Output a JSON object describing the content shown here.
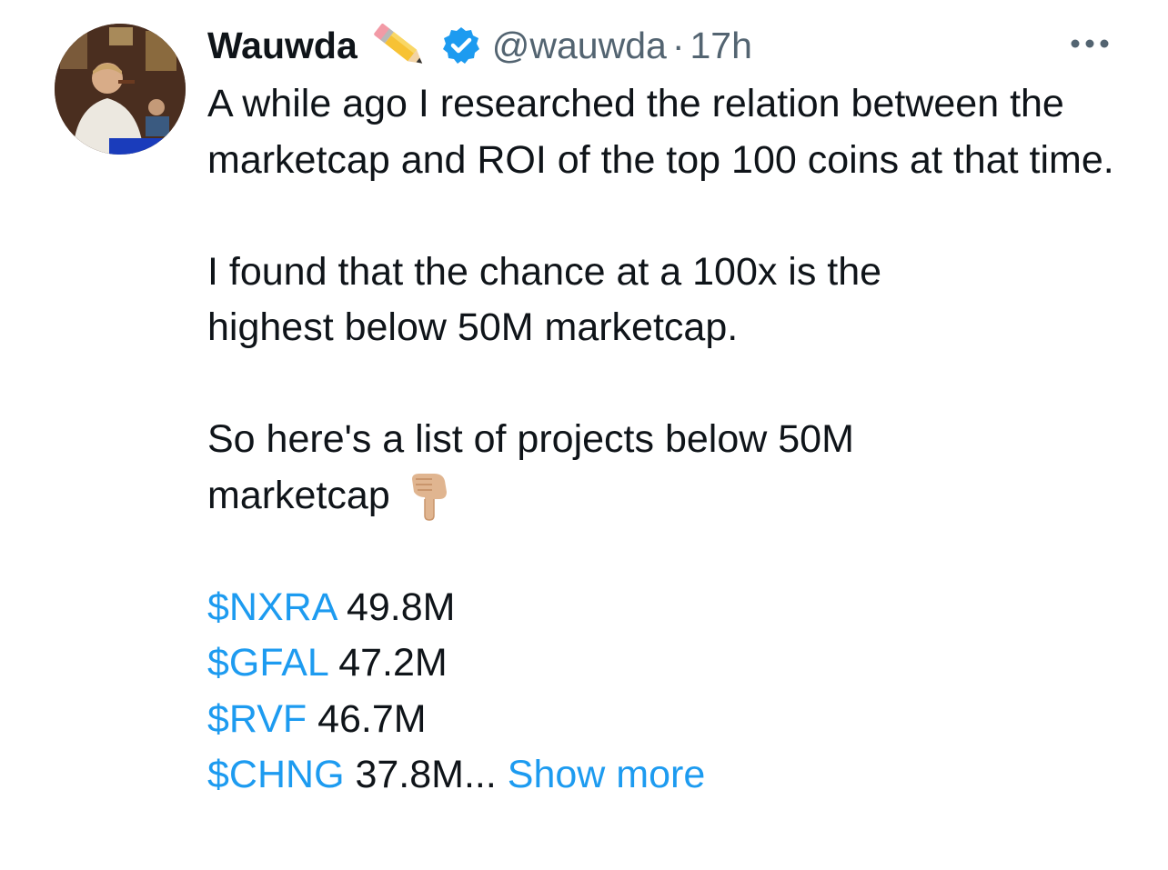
{
  "author": {
    "display_name": "Wauwda",
    "handle": "@wauwda",
    "separator": "·",
    "time_ago": "17h",
    "badge_emoji": "pencil-icon",
    "verified": true
  },
  "tweet": {
    "paragraph_1": "A while ago I researched the relation between the marketcap and ROI of the top 100 coins at that time.",
    "paragraph_2_line_1": "I found that the chance at a 100x is the",
    "paragraph_2_line_2": "highest below 50M marketcap.",
    "paragraph_3_line_1": "So here's a list of projects below 50M",
    "paragraph_3_line_2": "marketcap",
    "list": [
      {
        "cashtag": "$NXRA",
        "value": " 49.8M"
      },
      {
        "cashtag": "$GFAL",
        "value": " 47.2M"
      },
      {
        "cashtag": "$RVF",
        "value": " 46.7M"
      },
      {
        "cashtag": "$CHNG",
        "value": " 37.8M..."
      }
    ],
    "show_more_label": " Show more"
  },
  "colors": {
    "link": "#1d9bf0",
    "secondary_text": "#536471",
    "primary_text": "#0f1419",
    "verified_badge": "#1d9bf0"
  }
}
